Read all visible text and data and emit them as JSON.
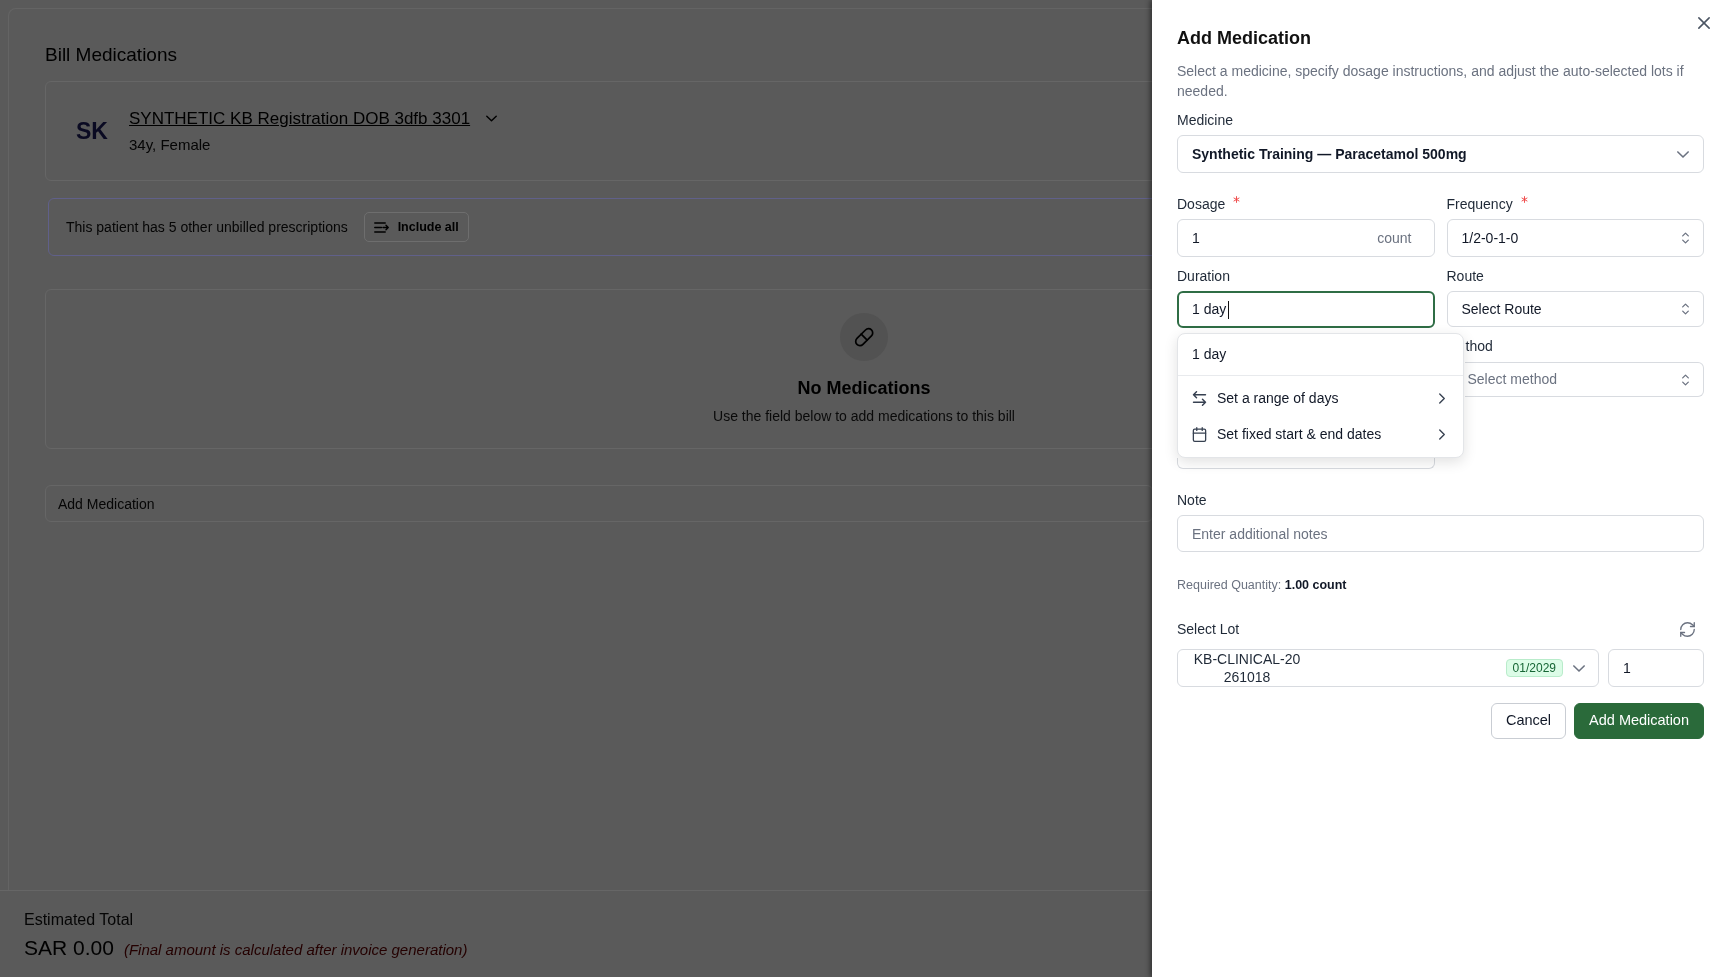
{
  "page": {
    "title": "Bill Medications",
    "patient": {
      "initials": "SK",
      "name": "SYNTHETIC KB Registration DOB 3dfb 3301",
      "details": "34y, Female"
    },
    "notice": {
      "text": "This patient has 5 other unbilled prescriptions",
      "button": "Include all"
    },
    "empty_state": {
      "title": "No Medications",
      "subtitle": "Use the field below to add medications to this bill"
    },
    "add_medication_field": {
      "placeholder": "Add Medication"
    },
    "footer": {
      "label": "Estimated Total",
      "total": "SAR 0.00",
      "note": "(Final amount is calculated after invoice generation)"
    }
  },
  "drawer": {
    "title": "Add Medication",
    "description": "Select a medicine, specify dosage instructions, and adjust the auto-selected lots if needed.",
    "medicine": {
      "label": "Medicine",
      "value": "Synthetic Training — Paracetamol 500mg"
    },
    "dosage": {
      "label": "Dosage",
      "required": true,
      "value": "1",
      "unit": "count"
    },
    "frequency": {
      "label": "Frequency",
      "required": true,
      "value": "1/2-0-1-0"
    },
    "duration": {
      "label": "Duration",
      "value": "1 day",
      "focused": true
    },
    "route": {
      "label": "Route",
      "value": "Select Route"
    },
    "method": {
      "label": "thod",
      "placeholder": "Select method"
    },
    "duration_menu": [
      {
        "kind": "option",
        "label": "1 day"
      },
      {
        "kind": "range",
        "label": "Set a range of days"
      },
      {
        "kind": "dates",
        "label": "Set fixed start & end dates"
      }
    ],
    "note": {
      "label": "Note",
      "placeholder": "Enter additional notes"
    },
    "required_quantity": "Required Quantity: **1.00 count**",
    "lot": {
      "label": "Select Lot",
      "lot_number_lines": [
        "KB-CLINICAL-20",
        "261018"
      ],
      "expiry": "01/2029",
      "quantity": "1"
    },
    "buttons": [
      {
        "kind": "secondary",
        "label": "Cancel"
      },
      {
        "kind": "primary",
        "label": "Add Medication"
      }
    ]
  }
}
